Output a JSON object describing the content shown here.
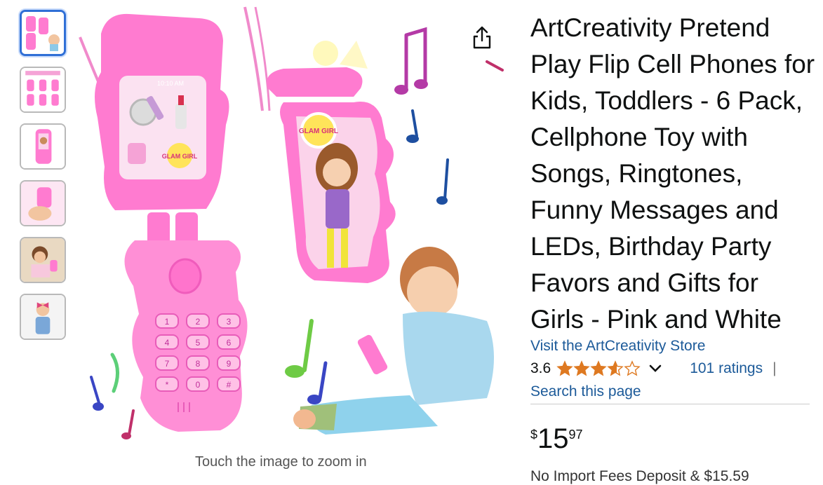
{
  "product": {
    "title": "ArtCreativity Pretend Play Flip Cell Phones for Kids, Toddlers - 6 Pack, Cellphone Toy with Songs, Ringtones, Funny Messages and LEDs, Birthday Party Favors and Gifts for Girls - Pink and White",
    "store_link": "Visit the ArtCreativity Store",
    "rating_value": "3.6",
    "rating_stars": 3.6,
    "ratings_count": "101 ratings",
    "separator": "|",
    "search_link": "Search this page",
    "price_symbol": "$",
    "price_whole": "15",
    "price_fraction": "97",
    "delivery_cutoff": "No Import Fees Deposit & $15.59"
  },
  "gallery": {
    "zoom_hint": "Touch the image to zoom in",
    "phone_screen_text": "10:10 AM",
    "brand_badge": "GLAM GIRL",
    "keypad_keys": [
      "1",
      "2",
      "3",
      "4",
      "5",
      "6",
      "7",
      "8",
      "9",
      "*",
      "0",
      "#"
    ],
    "thumbnails": [
      "thumbnail-phones-and-child",
      "thumbnail-six-pack",
      "thumbnail-single-phone",
      "thumbnail-phone-in-hand",
      "thumbnail-child-playing",
      "thumbnail-girl-with-bow"
    ],
    "selected_thumbnail": 0
  },
  "icons": {
    "share": "share-icon",
    "star": "star-icon",
    "chevron": "chevron-down-icon"
  },
  "colors": {
    "link": "#1c5a99",
    "star": "#de7921",
    "selected_border": "#2f6fd6",
    "toy_pink": "#ff7bd0"
  }
}
